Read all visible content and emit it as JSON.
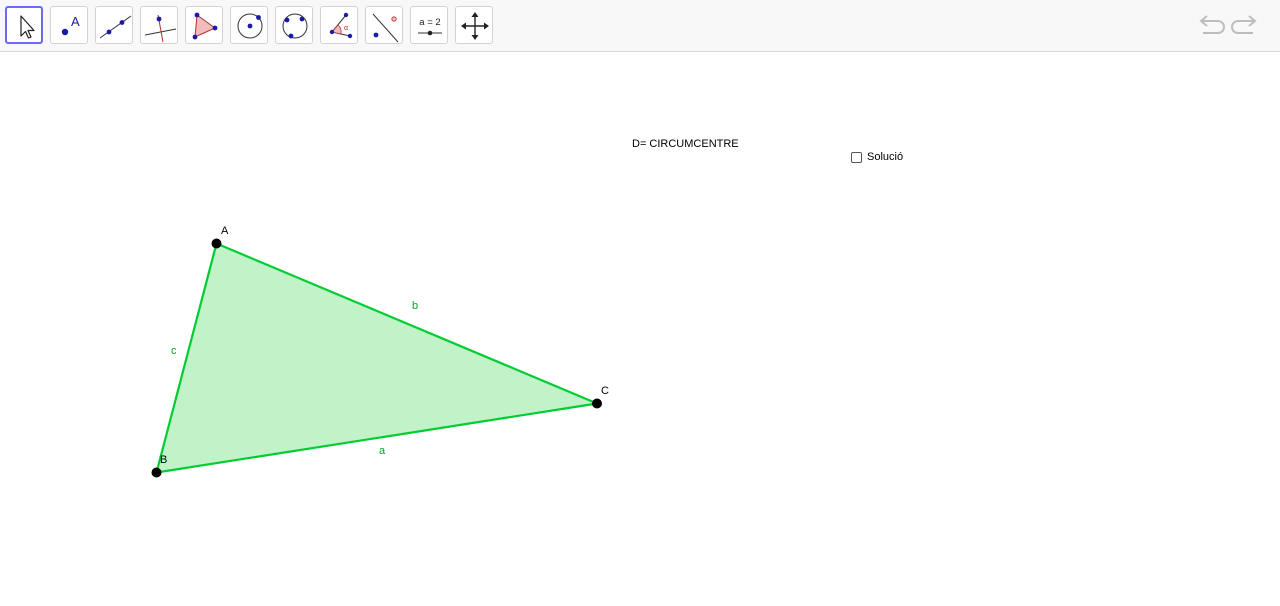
{
  "toolbar": {
    "tools": [
      {
        "icon": "move-arrow-icon",
        "selected": true
      },
      {
        "icon": "point-icon",
        "point_label": "A"
      },
      {
        "icon": "line-icon"
      },
      {
        "icon": "perpendicular-line-icon"
      },
      {
        "icon": "polygon-icon"
      },
      {
        "icon": "circle-center-point-icon"
      },
      {
        "icon": "circle-three-points-icon"
      },
      {
        "icon": "angle-icon",
        "angle_label": "α"
      },
      {
        "icon": "reflect-about-line-icon"
      },
      {
        "icon": "slider-icon",
        "slider_label": "a = 2"
      },
      {
        "icon": "move-graphics-view-icon"
      }
    ],
    "undo_icon": "undo-icon",
    "redo_icon": "redo-icon"
  },
  "construction": {
    "note": "D= CIRCUMCENTRE",
    "checkbox": {
      "label": "Solució",
      "checked": false
    },
    "points": [
      {
        "name": "A"
      },
      {
        "name": "B"
      },
      {
        "name": "C"
      }
    ],
    "segments": [
      {
        "name": "a"
      },
      {
        "name": "b"
      },
      {
        "name": "c"
      }
    ],
    "colors": {
      "triangle_stroke": "#00cc33",
      "triangle_fill": "#c1f2c8",
      "segment_label": "#00aa22",
      "point": "#000000",
      "selected_tool_border": "#6b6bef"
    }
  }
}
